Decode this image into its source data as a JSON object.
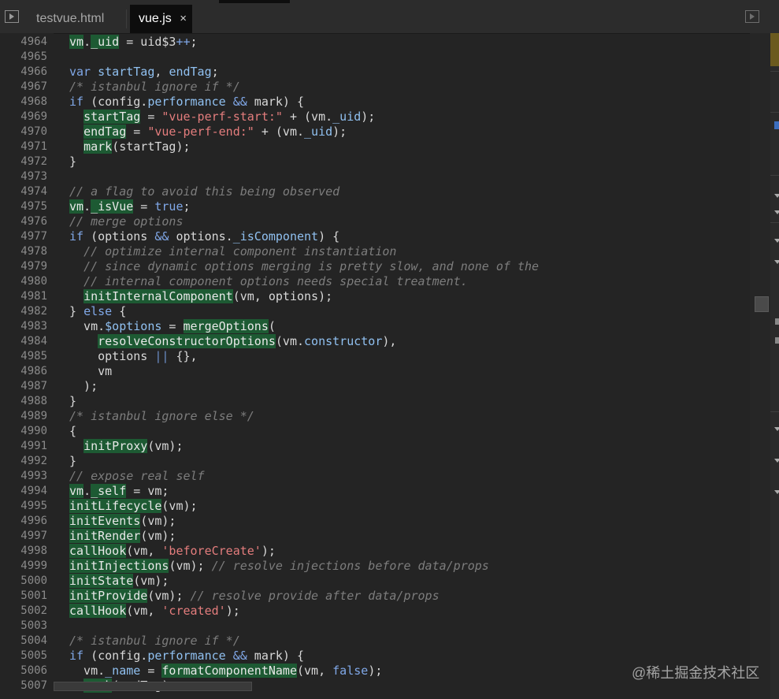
{
  "tabs": [
    {
      "label": "testvue.html",
      "active": false
    },
    {
      "label": "vue.js",
      "active": true,
      "close_glyph": "×"
    }
  ],
  "icons": {
    "left_toggle": "file-navigator-toggle-icon",
    "right_toggle": "sidebar-toggle-icon",
    "close": "close-icon"
  },
  "colors": {
    "background": "#242424",
    "keyword": "#80a8e8",
    "comment": "#7d7d7d",
    "string": "#e47d7d",
    "highlight": "#1d5a33",
    "gutter_text": "#8a8a8a"
  },
  "line_numbers": [
    "4964",
    "4965",
    "4966",
    "4967",
    "4968",
    "4969",
    "4970",
    "4971",
    "4972",
    "4973",
    "4974",
    "4975",
    "4976",
    "4977",
    "4978",
    "4979",
    "4980",
    "4981",
    "4982",
    "4983",
    "4984",
    "4985",
    "4986",
    "4987",
    "4988",
    "4989",
    "4990",
    "4991",
    "4992",
    "4993",
    "4994",
    "4995",
    "4996",
    "4997",
    "4998",
    "4999",
    "5000",
    "5001",
    "5002",
    "5003",
    "5004",
    "5005",
    "5006",
    "5007"
  ],
  "code_lines": [
    [
      [
        "hi",
        "vm"
      ],
      [
        "p",
        "."
      ],
      [
        "hi",
        "_uid"
      ],
      [
        "p",
        " = uid$3"
      ],
      [
        "k",
        "++"
      ],
      [
        "p",
        ";"
      ]
    ],
    [],
    [
      [
        "k",
        "var "
      ],
      [
        "v",
        "startTag"
      ],
      [
        "p",
        ", "
      ],
      [
        "v",
        "endTag"
      ],
      [
        "p",
        ";"
      ]
    ],
    [
      [
        "c",
        "/* istanbul ignore if */"
      ]
    ],
    [
      [
        "k",
        "if"
      ],
      [
        "p",
        " (config."
      ],
      [
        "v",
        "performance"
      ],
      [
        "p",
        " "
      ],
      [
        "k",
        "&&"
      ],
      [
        "p",
        " mark) {"
      ]
    ],
    [
      [
        "p",
        "  "
      ],
      [
        "hi",
        "startTag"
      ],
      [
        "p",
        " = "
      ],
      [
        "s",
        "\"vue-perf-start:\""
      ],
      [
        "p",
        " + (vm."
      ],
      [
        "v",
        "_uid"
      ],
      [
        "p",
        ");"
      ]
    ],
    [
      [
        "p",
        "  "
      ],
      [
        "hi",
        "endTag"
      ],
      [
        "p",
        " = "
      ],
      [
        "s",
        "\"vue-perf-end:\""
      ],
      [
        "p",
        " + (vm."
      ],
      [
        "v",
        "_uid"
      ],
      [
        "p",
        ");"
      ]
    ],
    [
      [
        "p",
        "  "
      ],
      [
        "hi",
        "mark"
      ],
      [
        "p",
        "(startTag);"
      ]
    ],
    [
      [
        "p",
        "}"
      ]
    ],
    [],
    [
      [
        "c",
        "// a flag to avoid this being observed"
      ]
    ],
    [
      [
        "hi",
        "vm"
      ],
      [
        "p",
        "."
      ],
      [
        "hi",
        "_isVue"
      ],
      [
        "p",
        " = "
      ],
      [
        "k",
        "true"
      ],
      [
        "p",
        ";"
      ]
    ],
    [
      [
        "c",
        "// merge options"
      ]
    ],
    [
      [
        "k",
        "if"
      ],
      [
        "p",
        " (options "
      ],
      [
        "k",
        "&&"
      ],
      [
        "p",
        " options."
      ],
      [
        "v",
        "_isComponent"
      ],
      [
        "p",
        ") {"
      ]
    ],
    [
      [
        "p",
        "  "
      ],
      [
        "c",
        "// optimize internal component instantiation"
      ]
    ],
    [
      [
        "p",
        "  "
      ],
      [
        "c",
        "// since dynamic options merging is pretty slow, and none of the"
      ]
    ],
    [
      [
        "p",
        "  "
      ],
      [
        "c",
        "// internal component options needs special treatment."
      ]
    ],
    [
      [
        "p",
        "  "
      ],
      [
        "hi",
        "initInternalComponent"
      ],
      [
        "p",
        "(vm, options);"
      ]
    ],
    [
      [
        "p",
        "} "
      ],
      [
        "k",
        "else"
      ],
      [
        "p",
        " {"
      ]
    ],
    [
      [
        "p",
        "  vm."
      ],
      [
        "v",
        "$options"
      ],
      [
        "p",
        " = "
      ],
      [
        "hi",
        "mergeOptions"
      ],
      [
        "p",
        "("
      ]
    ],
    [
      [
        "p",
        "    "
      ],
      [
        "hi",
        "resolveConstructorOptions"
      ],
      [
        "p",
        "(vm."
      ],
      [
        "v",
        "constructor"
      ],
      [
        "p",
        "),"
      ]
    ],
    [
      [
        "p",
        "    options "
      ],
      [
        "bp",
        "||"
      ],
      [
        "p",
        " {},"
      ]
    ],
    [
      [
        "p",
        "    vm"
      ]
    ],
    [
      [
        "p",
        "  );"
      ]
    ],
    [
      [
        "p",
        "}"
      ]
    ],
    [
      [
        "c",
        "/* istanbul ignore else */"
      ]
    ],
    [
      [
        "p",
        "{"
      ]
    ],
    [
      [
        "p",
        "  "
      ],
      [
        "hi",
        "initProxy"
      ],
      [
        "p",
        "(vm);"
      ]
    ],
    [
      [
        "p",
        "}"
      ]
    ],
    [
      [
        "c",
        "// expose real self"
      ]
    ],
    [
      [
        "hi",
        "vm"
      ],
      [
        "p",
        "."
      ],
      [
        "hi",
        "_self"
      ],
      [
        "p",
        " = vm;"
      ]
    ],
    [
      [
        "hi",
        "initLifecycle"
      ],
      [
        "p",
        "(vm);"
      ]
    ],
    [
      [
        "hi",
        "initEvents"
      ],
      [
        "p",
        "(vm);"
      ]
    ],
    [
      [
        "hi",
        "initRender"
      ],
      [
        "p",
        "(vm);"
      ]
    ],
    [
      [
        "hi",
        "callHook"
      ],
      [
        "p",
        "(vm, "
      ],
      [
        "s",
        "'beforeCreate'"
      ],
      [
        "p",
        ");"
      ]
    ],
    [
      [
        "hi",
        "initInjections"
      ],
      [
        "p",
        "(vm); "
      ],
      [
        "c",
        "// resolve injections before data/props"
      ]
    ],
    [
      [
        "hi",
        "initState"
      ],
      [
        "p",
        "(vm);"
      ]
    ],
    [
      [
        "hi",
        "initProvide"
      ],
      [
        "p",
        "(vm); "
      ],
      [
        "c",
        "// resolve provide after data/props"
      ]
    ],
    [
      [
        "hi",
        "callHook"
      ],
      [
        "p",
        "(vm, "
      ],
      [
        "s",
        "'created'"
      ],
      [
        "p",
        ");"
      ]
    ],
    [],
    [
      [
        "c",
        "/* istanbul ignore if */"
      ]
    ],
    [
      [
        "k",
        "if"
      ],
      [
        "p",
        " (config."
      ],
      [
        "v",
        "performance"
      ],
      [
        "p",
        " "
      ],
      [
        "k",
        "&&"
      ],
      [
        "p",
        " mark) {"
      ]
    ],
    [
      [
        "p",
        "  vm."
      ],
      [
        "v",
        "_name"
      ],
      [
        "p",
        " = "
      ],
      [
        "hi",
        "formatComponentName"
      ],
      [
        "p",
        "(vm, "
      ],
      [
        "k",
        "false"
      ],
      [
        "p",
        ");"
      ]
    ],
    [
      [
        "p",
        "  "
      ],
      [
        "hi",
        "mark"
      ],
      [
        "p",
        "(endTag);"
      ]
    ]
  ],
  "watermark": "@稀土掘金技术社区"
}
